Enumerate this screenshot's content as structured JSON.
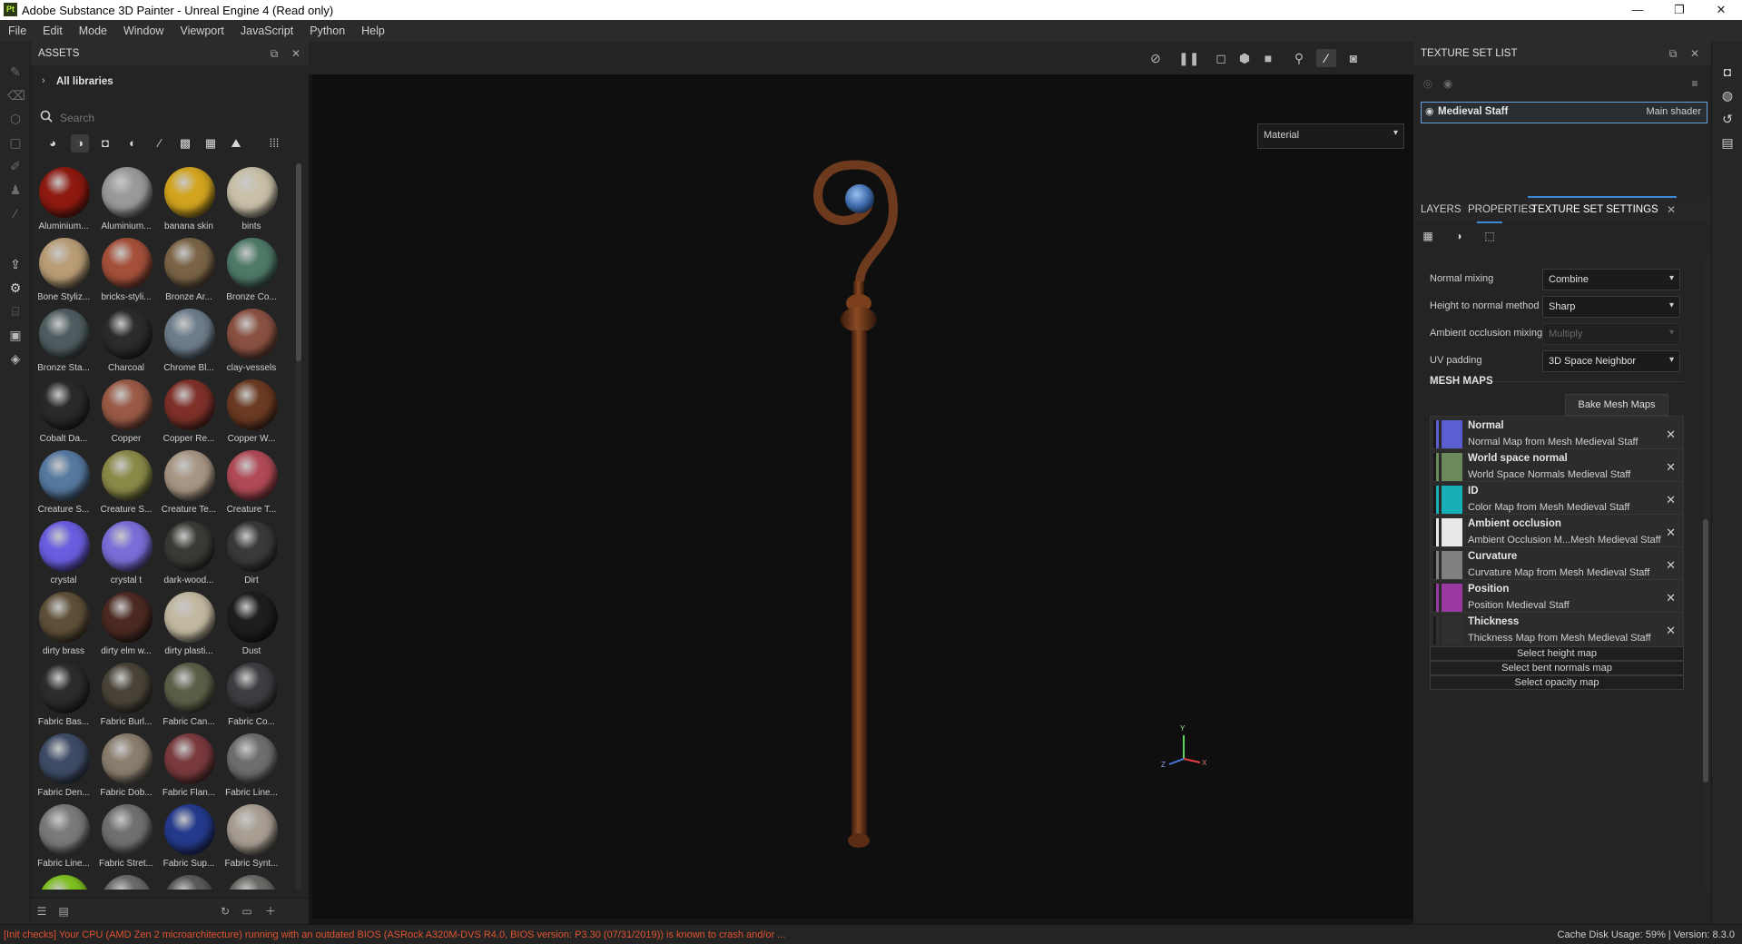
{
  "window": {
    "title": "Adobe Substance 3D Painter - Unreal Engine 4 (Read only)",
    "app_icon_text": "Pt",
    "controls": {
      "minimize": "—",
      "maximize": "❐",
      "close": "✕"
    }
  },
  "menu": [
    "File",
    "Edit",
    "Mode",
    "Window",
    "Viewport",
    "JavaScript",
    "Python",
    "Help"
  ],
  "assets": {
    "title": "ASSETS",
    "library": "All libraries",
    "search_placeholder": "Search",
    "items": [
      {
        "label": "Aluminium...",
        "color": "#8e1a10"
      },
      {
        "label": "Aluminium...",
        "color": "#9a9a9a"
      },
      {
        "label": "banana skin",
        "color": "#d2a51f"
      },
      {
        "label": "bints",
        "color": "#c9c0a8"
      },
      {
        "label": "Bone Styliz...",
        "color": "#b99d76"
      },
      {
        "label": "bricks-styli...",
        "color": "#a5503a"
      },
      {
        "label": "Bronze Ar...",
        "color": "#7a6446"
      },
      {
        "label": "Bronze Co...",
        "color": "#4e7a68"
      },
      {
        "label": "Bronze Sta...",
        "color": "#4f5d60"
      },
      {
        "label": "Charcoal",
        "color": "#2c2c2c"
      },
      {
        "label": "Chrome Bl...",
        "color": "#6e7d8c"
      },
      {
        "label": "clay-vessels",
        "color": "#8a5142"
      },
      {
        "label": "Cobalt Da...",
        "color": "#2a2a28"
      },
      {
        "label": "Copper",
        "color": "#9a5a46"
      },
      {
        "label": "Copper Re...",
        "color": "#7e3029"
      },
      {
        "label": "Copper W...",
        "color": "#6b3a22"
      },
      {
        "label": "Creature S...",
        "color": "#5679a0"
      },
      {
        "label": "Creature S...",
        "color": "#8a8a48"
      },
      {
        "label": "Creature Te...",
        "color": "#a89684"
      },
      {
        "label": "Creature T...",
        "color": "#b04a56"
      },
      {
        "label": "crystal",
        "color": "#6a5ee0"
      },
      {
        "label": "crystal t",
        "color": "#7a6ed8"
      },
      {
        "label": "dark-wood...",
        "color": "#3b3a35"
      },
      {
        "label": "Dirt",
        "color": "#3a3a38"
      },
      {
        "label": "dirty brass",
        "color": "#5e5038"
      },
      {
        "label": "dirty elm w...",
        "color": "#4c2a22"
      },
      {
        "label": "dirty plasti...",
        "color": "#c2b9a0"
      },
      {
        "label": "Dust",
        "color": "#1e1e1e"
      },
      {
        "label": "Fabric Bas...",
        "color": "#2c2c2c"
      },
      {
        "label": "Fabric Burl...",
        "color": "#4a4438"
      },
      {
        "label": "Fabric Can...",
        "color": "#5a6048"
      },
      {
        "label": "Fabric Co...",
        "color": "#3e3e42"
      },
      {
        "label": "Fabric Den...",
        "color": "#3e4c66"
      },
      {
        "label": "Fabric Dob...",
        "color": "#8a7e6e"
      },
      {
        "label": "Fabric Flan...",
        "color": "#7a3a3e"
      },
      {
        "label": "Fabric Line...",
        "color": "#6e6e6e"
      },
      {
        "label": "Fabric Line...",
        "color": "#7a7a7a"
      },
      {
        "label": "Fabric Stret...",
        "color": "#707070"
      },
      {
        "label": "Fabric Sup...",
        "color": "#243a8c"
      },
      {
        "label": "Fabric Synt...",
        "color": "#a89e92"
      },
      {
        "label": "",
        "color": "#7ec020"
      },
      {
        "label": "",
        "color": "#6a6a6a"
      },
      {
        "label": "",
        "color": "#5a5a58"
      },
      {
        "label": "",
        "color": "#6c6a66"
      }
    ]
  },
  "viewport": {
    "shading_mode": "Material",
    "axis_labels": {
      "y": "Y",
      "x": "X",
      "z": "Z"
    }
  },
  "texture_set_list": {
    "title": "TEXTURE SET LIST",
    "set_name": "Medieval Staff",
    "shader": "Main shader"
  },
  "tabs": [
    "LAYERS",
    "PROPERTIES",
    "TEXTURE SET SETTINGS"
  ],
  "settings": [
    {
      "key": "Normal mixing",
      "value": "Combine",
      "disabled": false
    },
    {
      "key": "Height to normal method",
      "value": "Sharp",
      "disabled": false
    },
    {
      "key": "Ambient occlusion mixing",
      "value": "Multiply",
      "disabled": true
    },
    {
      "key": "UV padding",
      "value": "3D Space Neighbor",
      "disabled": false
    }
  ],
  "mesh_maps": {
    "title": "MESH MAPS",
    "bake_label": "Bake Mesh Maps",
    "items": [
      {
        "name": "Normal",
        "desc": "Normal Map from Mesh Medieval Staff",
        "color": "#5a5ed0"
      },
      {
        "name": "World space normal",
        "desc": "World Space Normals Medieval Staff",
        "color": "#6a8a5a"
      },
      {
        "name": "ID",
        "desc": "Color Map from Mesh Medieval Staff",
        "color": "#18b0b8"
      },
      {
        "name": "Ambient occlusion",
        "desc": "Ambient Occlusion M...Mesh Medieval Staff",
        "color": "#e8e8e8"
      },
      {
        "name": "Curvature",
        "desc": "Curvature Map from Mesh Medieval Staff",
        "color": "#808080"
      },
      {
        "name": "Position",
        "desc": "Position Medieval Staff",
        "color": "#9a3aa0"
      },
      {
        "name": "Thickness",
        "desc": "Thickness Map from Mesh Medieval Staff",
        "color": "#303030"
      }
    ],
    "select_buttons": [
      "Select height map",
      "Select bent normals map",
      "Select opacity map"
    ]
  },
  "status": {
    "message": "[Init checks] Your CPU (AMD Zen 2 microarchitecture) running with an outdated BIOS (ASRock A320M-DVS R4.0, BIOS version: P3.30 (07/31/2019)) is known to crash and/or ...",
    "cache": "Cache Disk Usage:  59% | Version: 8.3.0"
  }
}
